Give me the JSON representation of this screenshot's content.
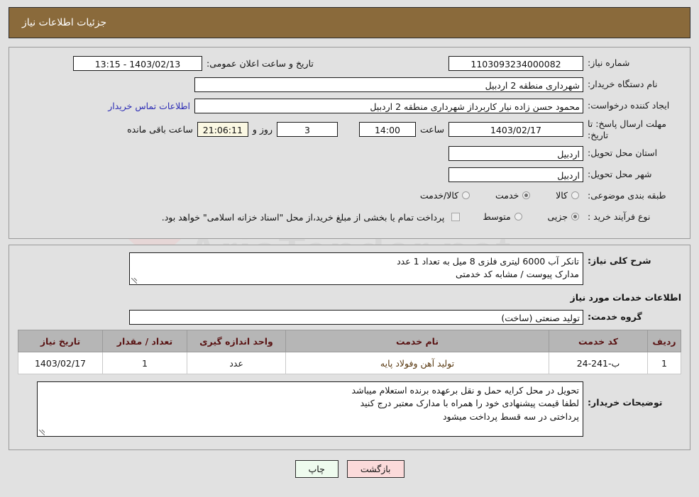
{
  "header": {
    "title": "جزئیات اطلاعات نیاز",
    "bar_color": "#8a6a3b"
  },
  "watermark": {
    "text": "AriaTender.net"
  },
  "info": {
    "need_number_label": "شماره نیاز:",
    "need_number_value": "1103093234000082",
    "public_announce_label": "تاریخ و ساعت اعلان عمومی:",
    "public_announce_value": "1403/02/13 - 13:15",
    "buyer_org_label": "نام دستگاه خریدار:",
    "buyer_org_value": "شهرداری منطقه 2 اردبیل",
    "requester_label": "ایجاد کننده درخواست:",
    "requester_value": "محمود حسن زاده نیار کاربرداز شهرداری منطقه 2 اردبیل",
    "buyer_contact_link": "اطلاعات تماس خریدار",
    "deadline_label": "مهلت ارسال پاسخ: تا تاریخ:",
    "deadline_date": "1403/02/17",
    "hour_label": "ساعت",
    "deadline_time": "14:00",
    "days_value": "3",
    "days_mid": "روز و",
    "countdown_value": "21:06:11",
    "countdown_suffix": "ساعت باقی مانده",
    "province_label": "استان محل تحویل:",
    "province_value": "اردبیل",
    "city_label": "شهر محل تحویل:",
    "city_value": "اردبیل",
    "category_label": "طبقه بندی موضوعی:",
    "category_options": [
      {
        "label": "کالا",
        "selected": false
      },
      {
        "label": "خدمت",
        "selected": true
      },
      {
        "label": "کالا/خدمت",
        "selected": false
      }
    ],
    "process_label": "نوع فرآیند خرید :",
    "process_options": [
      {
        "label": "جزیی",
        "selected": true
      },
      {
        "label": "متوسط",
        "selected": false
      }
    ],
    "treasury_note": "پرداخت تمام یا بخشی از مبلغ خرید،از محل \"اسناد خزانه اسلامی\" خواهد بود."
  },
  "details": {
    "summary_label": "شرح کلی نیاز:",
    "summary_value": "تانکر آب 6000 لیتری فلزی 8 میل  به تعداد 1 عدد\nمدارک پیوست / مشابه کد خدمتی",
    "services_section_title": "اطلاعات خدمات مورد نیاز",
    "service_group_label": "گروه خدمت:",
    "service_group_value": "تولید صنعتی (ساخت)",
    "table": {
      "columns": [
        "ردیف",
        "کد خدمت",
        "نام خدمت",
        "واحد اندازه گیری",
        "تعداد / مقدار",
        "تاریخ نیاز"
      ],
      "rows": [
        {
          "index": "1",
          "code": "ب-241-24",
          "name": "تولید آهن وفولاد پایه",
          "unit": "عدد",
          "qty": "1",
          "date": "1403/02/17"
        }
      ]
    },
    "buyer_notes_label": "توضیحات خریدار:",
    "buyer_notes_value": "تحویل در محل کرایه حمل و نقل برعهده برنده استعلام میباشد\nلطفا قیمت پیشنهادی خود را همراه با مدارک معتبر درج کنید\nپرداختی در سه قسط پرداخت میشود"
  },
  "footer": {
    "print_label": "چاپ",
    "back_label": "بازگشت"
  }
}
